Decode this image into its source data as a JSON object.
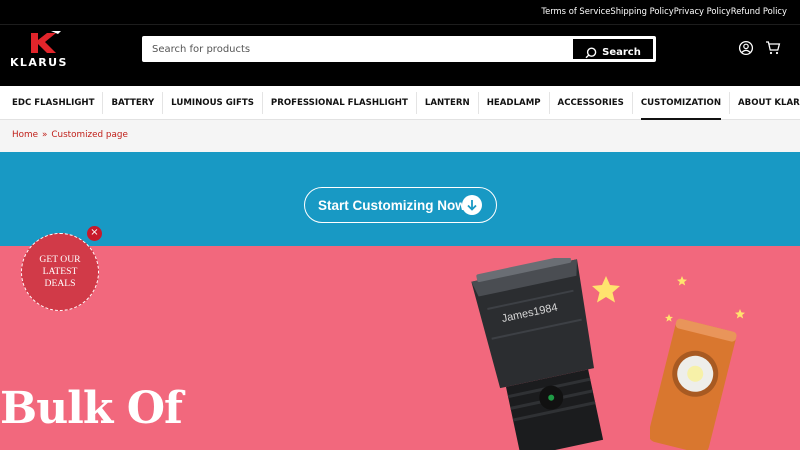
{
  "top_links": [
    "Terms of Service",
    "Shipping Policy",
    "Privacy Policy",
    "Refund Policy"
  ],
  "brand": {
    "logo_text": "KLARUS",
    "accent": "#e1252b"
  },
  "search": {
    "placeholder": "Search for products",
    "button_label": "Search"
  },
  "header_icons": [
    "account-icon",
    "cart-icon"
  ],
  "nav": {
    "items": [
      {
        "label": "EDC FLASHLIGHT"
      },
      {
        "label": "BATTERY"
      },
      {
        "label": "LUMINOUS GIFTS"
      },
      {
        "label": "PROFESSIONAL FLASHLIGHT"
      },
      {
        "label": "LANTERN"
      },
      {
        "label": "HEADLAMP"
      },
      {
        "label": "ACCESSORIES"
      },
      {
        "label": "CUSTOMIZATION",
        "active": true
      },
      {
        "label": "ABOUT KLARUS",
        "has_dropdown": true
      }
    ]
  },
  "breadcrumb": {
    "home": "Home",
    "separator": "»",
    "current": "Customized page"
  },
  "cta": {
    "label": "Start Customizing Now"
  },
  "promo": {
    "lines": [
      "GET OUR",
      "LATEST",
      "DEALS"
    ],
    "close": "×"
  },
  "hero": {
    "title": "Bulk Of",
    "engraving": "James1984",
    "colors": {
      "blue_band": "#1899c4",
      "pink_band": "#f2687d",
      "badge": "#d13a48"
    }
  }
}
